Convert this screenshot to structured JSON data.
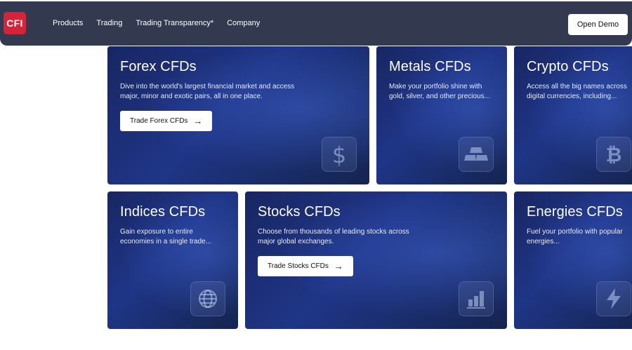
{
  "header": {
    "logo_text": "CFI",
    "nav": [
      "Products",
      "Trading",
      "Trading Transparency*",
      "Company"
    ],
    "cta": "Open Demo"
  },
  "cards": [
    {
      "title": "Forex CFDs",
      "desc": "Dive into the world's largest financial market and access major, minor and exotic pairs, all in one place.",
      "button": "Trade Forex CFDs",
      "icon": "dollar-icon"
    },
    {
      "title": "Metals CFDs",
      "desc": "Make your portfolio shine with gold, silver, and other precious...",
      "icon": "gold-bars-icon"
    },
    {
      "title": "Crypto CFDs",
      "desc": "Access all the big names across digital currencies, including...",
      "icon": "bitcoin-icon"
    },
    {
      "title": "Indices CFDs",
      "desc": "Gain exposure to entire economies in a single trade...",
      "icon": "globe-icon"
    },
    {
      "title": "Stocks CFDs",
      "desc": "Choose from thousands of leading stocks across major global exchanges.",
      "button": "Trade Stocks CFDs",
      "icon": "bar-chart-icon"
    },
    {
      "title": "Energies CFDs",
      "desc": "Fuel your portfolio with popular energies...",
      "icon": "lightning-icon"
    }
  ],
  "colors": {
    "header_bg": "#333a4f",
    "logo_bg": "#d4243a",
    "card_bg": "#1f3587"
  }
}
